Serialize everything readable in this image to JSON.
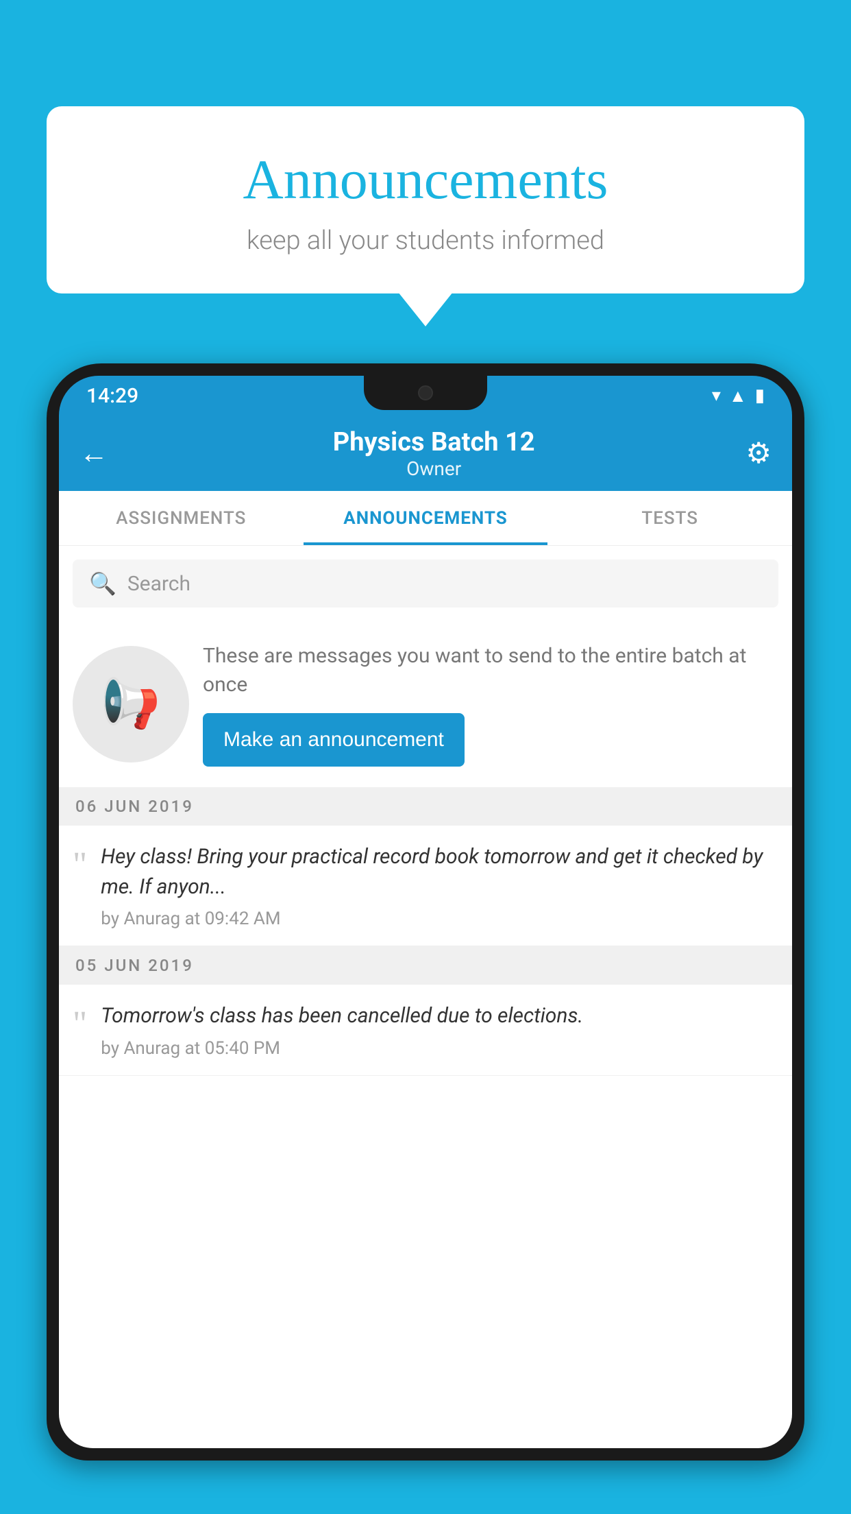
{
  "background": {
    "color": "#1ab3e0"
  },
  "speech_bubble": {
    "title": "Announcements",
    "subtitle": "keep all your students informed"
  },
  "phone": {
    "status_bar": {
      "time": "14:29"
    },
    "app_bar": {
      "title": "Physics Batch 12",
      "subtitle": "Owner",
      "back_label": "←",
      "gear_label": "⚙"
    },
    "tabs": [
      {
        "label": "ASSIGNMENTS",
        "active": false
      },
      {
        "label": "ANNOUNCEMENTS",
        "active": true
      },
      {
        "label": "TESTS",
        "active": false
      }
    ],
    "search": {
      "placeholder": "Search"
    },
    "promo": {
      "description": "These are messages you want to send to the entire batch at once",
      "button_label": "Make an announcement"
    },
    "announcements": [
      {
        "date": "06  JUN  2019",
        "text": "Hey class! Bring your practical record book tomorrow and get it checked by me. If anyon...",
        "meta": "by Anurag at 09:42 AM"
      },
      {
        "date": "05  JUN  2019",
        "text": "Tomorrow's class has been cancelled due to elections.",
        "meta": "by Anurag at 05:40 PM"
      }
    ]
  }
}
